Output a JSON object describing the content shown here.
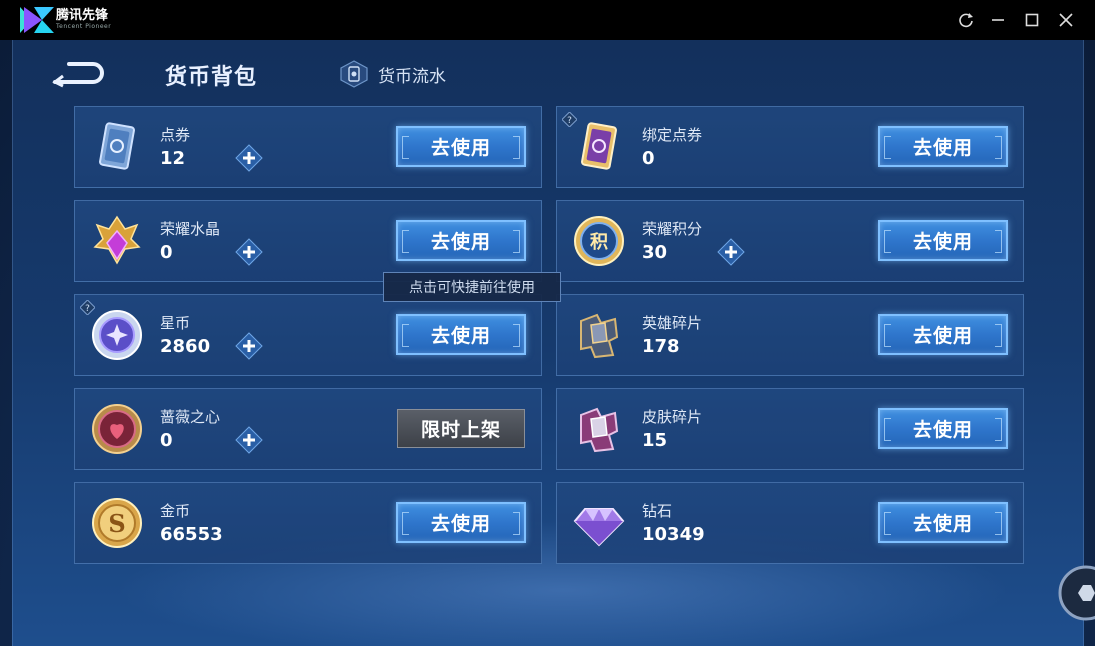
{
  "window": {
    "app_name": "腾讯先锋",
    "app_sub": "Tencent Pioneer",
    "controls": [
      "refresh-icon",
      "minimize-icon",
      "maximize-icon",
      "close-icon"
    ]
  },
  "header": {
    "title": "货币背包",
    "flow_tab": "货币流水"
  },
  "tooltip": "点击可快捷前往使用",
  "cards": [
    {
      "name": "点券",
      "amount": "12",
      "button": "去使用",
      "icon": "ticket-icon"
    },
    {
      "name": "绑定点券",
      "amount": "0",
      "button": "去使用",
      "icon": "bound-ticket-icon"
    },
    {
      "name": "荣耀水晶",
      "amount": "0",
      "button": "去使用",
      "icon": "glory-crystal-icon"
    },
    {
      "name": "荣耀积分",
      "amount": "30",
      "button": "去使用",
      "icon": "glory-points-icon"
    },
    {
      "name": "星币",
      "amount": "2860",
      "button": "去使用",
      "icon": "star-coin-icon"
    },
    {
      "name": "英雄碎片",
      "amount": "178",
      "button": "去使用",
      "icon": "hero-fragment-icon"
    },
    {
      "name": "蔷薇之心",
      "amount": "0",
      "button": "限时上架",
      "icon": "rose-heart-icon"
    },
    {
      "name": "皮肤碎片",
      "amount": "15",
      "button": "去使用",
      "icon": "skin-fragment-icon"
    },
    {
      "name": "金币",
      "amount": "66553",
      "button": "去使用",
      "icon": "gold-coin-icon"
    },
    {
      "name": "钻石",
      "amount": "10349",
      "button": "去使用",
      "icon": "diamond-icon"
    }
  ],
  "colors": {
    "accent_button": "#2f76cc",
    "button_border": "#7fc0ff",
    "background": "#163a6d"
  }
}
